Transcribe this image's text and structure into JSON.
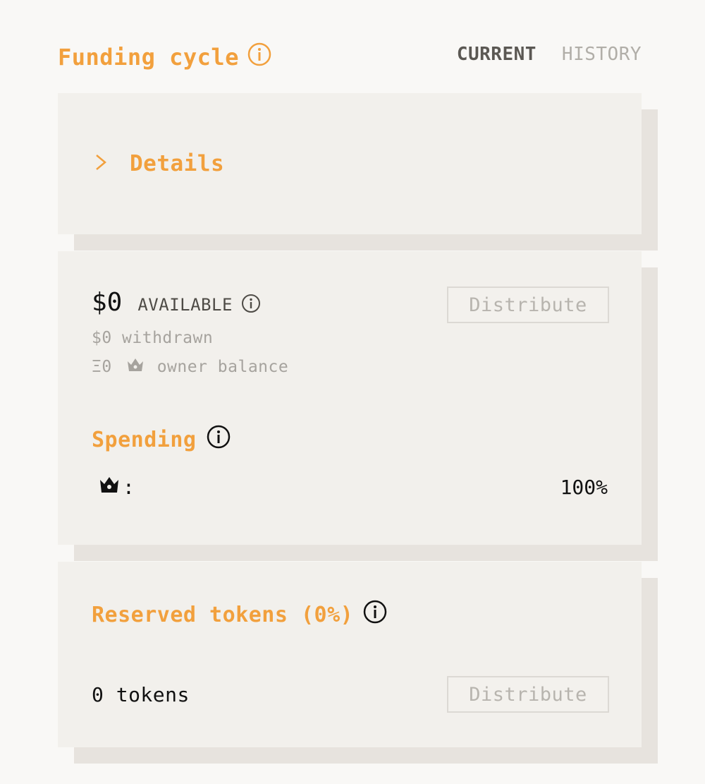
{
  "header": {
    "title": "Funding cycle",
    "tabs": [
      {
        "label": "CURRENT",
        "active": true
      },
      {
        "label": "HISTORY",
        "active": false
      }
    ]
  },
  "details": {
    "label": "Details",
    "icon": "chevron-right-icon"
  },
  "balance": {
    "amount": "$0",
    "available_label": "AVAILABLE",
    "withdrawn": "$0 withdrawn",
    "owner_amount": "Ξ0",
    "owner_label": "owner balance",
    "distribute_label": "Distribute"
  },
  "spending": {
    "title": "Spending",
    "row_separator": ":",
    "percent": "100%"
  },
  "reserved": {
    "title": "Reserved tokens (0%)",
    "tokens": "0 tokens",
    "distribute_label": "Distribute"
  },
  "colors": {
    "accent": "#f2a03d",
    "card": "#f2f0ec",
    "card_shadow": "#e7e3de",
    "background": "#f9f8f6"
  }
}
